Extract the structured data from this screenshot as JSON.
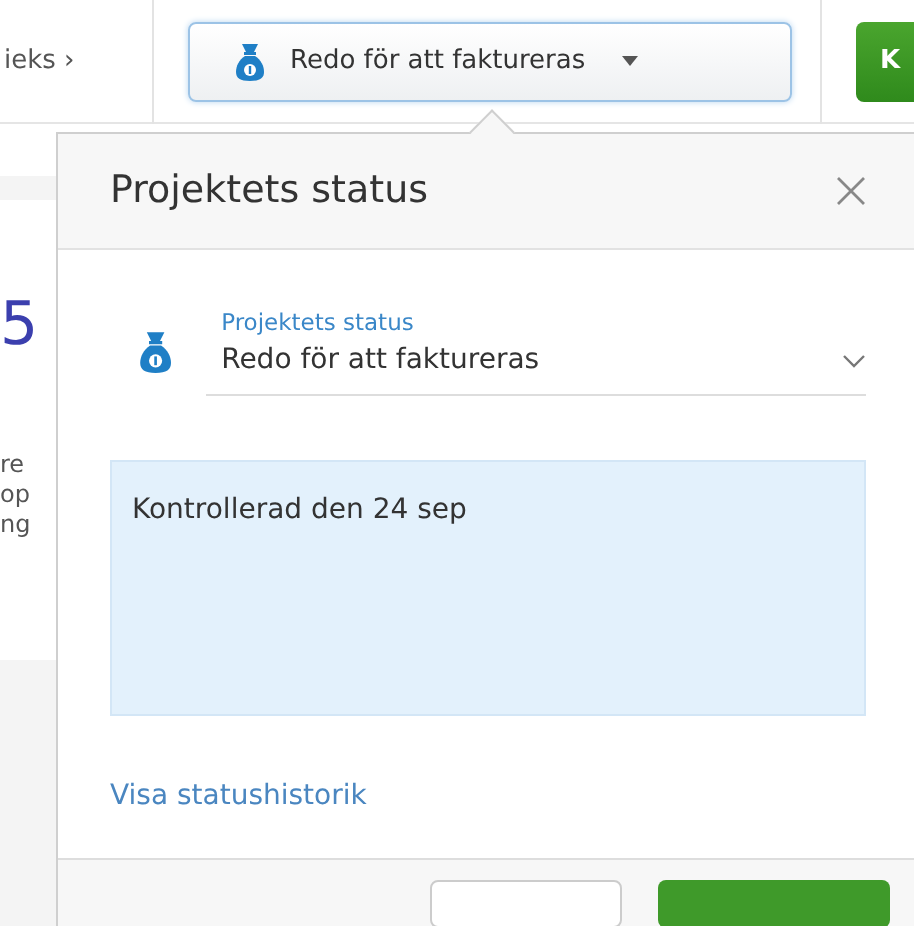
{
  "background": {
    "breadcrumb": "ieks ›",
    "status_button": {
      "label": "Redo för att faktureras"
    },
    "action_button": "K",
    "side_number": "5",
    "side_texts": [
      "re",
      "op",
      "ng"
    ]
  },
  "popover": {
    "title": "Projektets status",
    "status_field": {
      "label": "Projektets status",
      "value": "Redo för att faktureras"
    },
    "note": {
      "value": "Kontrollerad den 24 sep"
    },
    "history_link": "Visa statushistorik"
  }
}
